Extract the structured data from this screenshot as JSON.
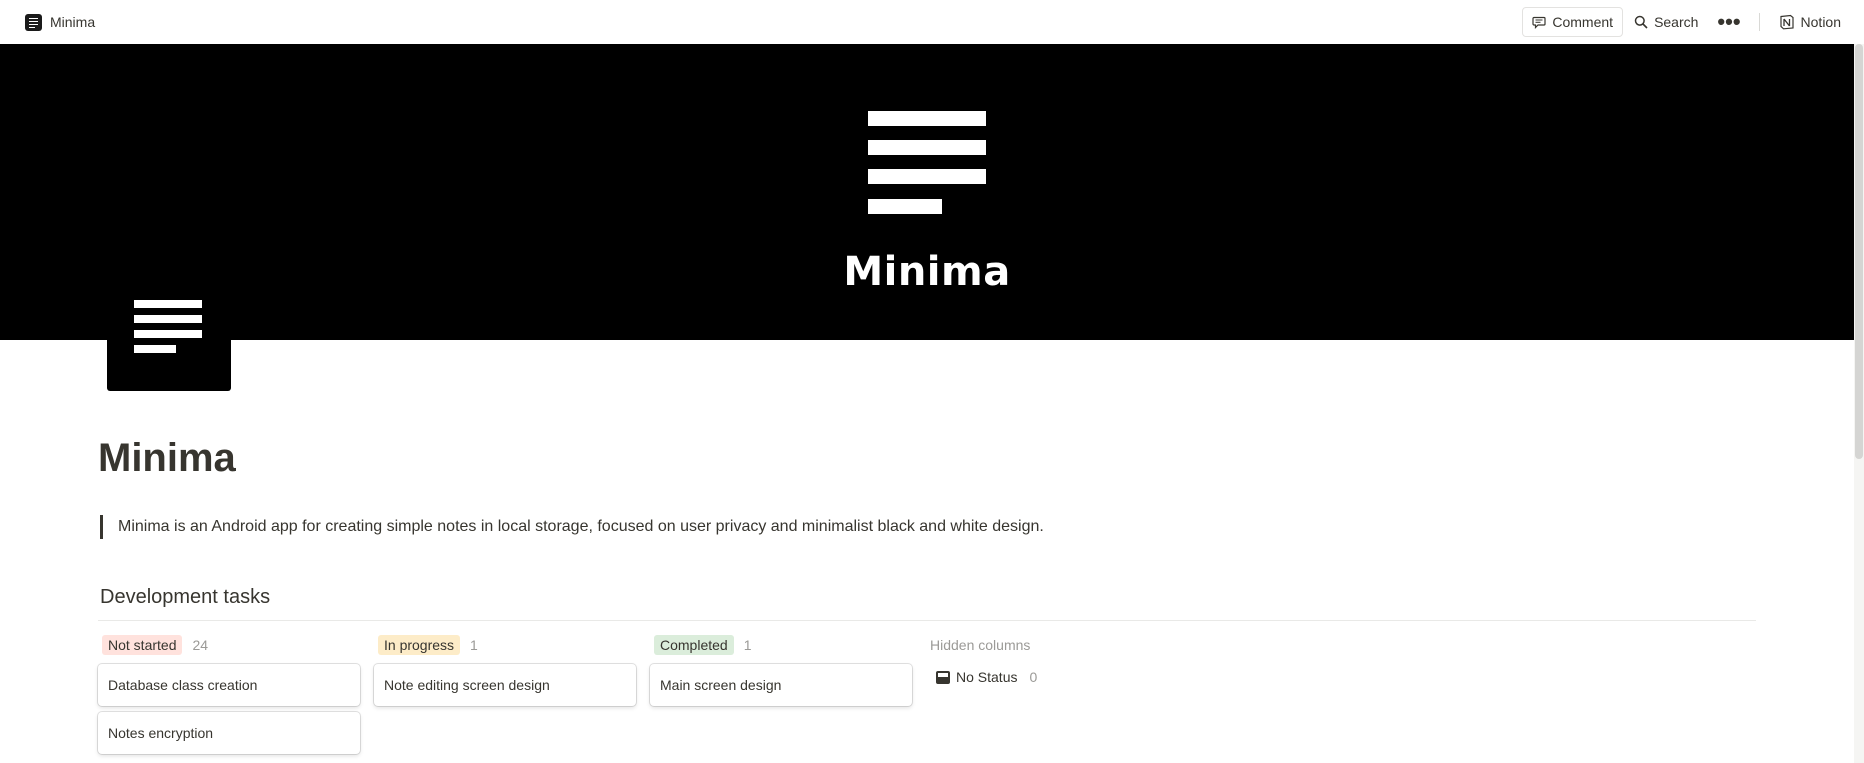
{
  "topbar": {
    "breadcrumb_title": "Minima",
    "comment_label": "Comment",
    "search_label": "Search",
    "more_label": "•••",
    "notion_label": "Notion"
  },
  "cover": {
    "title": "Minima",
    "background": "#000000"
  },
  "page": {
    "title": "Minima",
    "description": "Minima is an Android app for creating simple notes in local storage, focused on user privacy and minimalist black and white design."
  },
  "database": {
    "title": "Development tasks",
    "columns": [
      {
        "label": "Not started",
        "count": "24",
        "tag_bg": "#ffe2dd",
        "cards": [
          "Database class creation",
          "Notes encryption"
        ]
      },
      {
        "label": "In progress",
        "count": "1",
        "tag_bg": "#fdecc8",
        "cards": [
          "Note editing screen design"
        ]
      },
      {
        "label": "Completed",
        "count": "1",
        "tag_bg": "#dbeddb",
        "cards": [
          "Main screen design"
        ]
      }
    ],
    "hidden": {
      "label": "Hidden columns",
      "item_label": "No Status",
      "item_count": "0"
    }
  }
}
